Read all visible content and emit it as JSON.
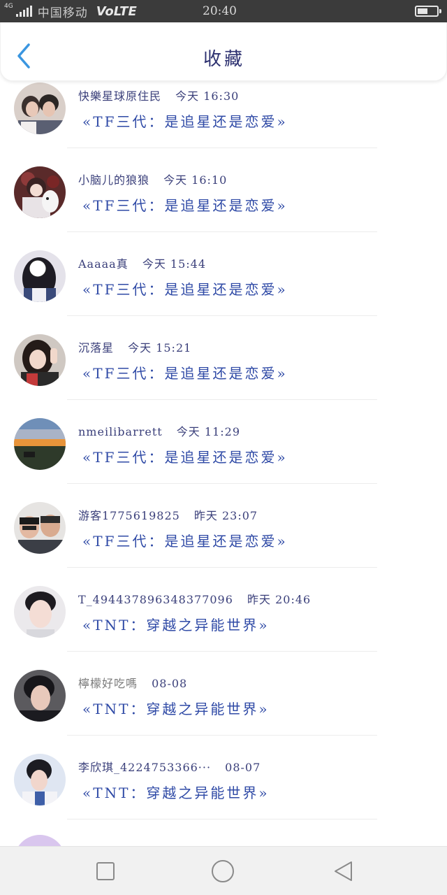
{
  "status_bar": {
    "network": "4G",
    "carrier": "中国移动",
    "volte": "VoLTE",
    "time": "20:40",
    "battery_level": 0.55
  },
  "header": {
    "back_icon": "chevron-left-icon",
    "title": "收藏"
  },
  "items": [
    {
      "name": "快樂星球原住民",
      "time": "今天 16:30",
      "book": "«TF三代：是追星还是恋爱»"
    },
    {
      "name": "小脑儿的狼狼",
      "time": "今天 16:10",
      "book": "«TF三代：是追星还是恋爱»"
    },
    {
      "name": "Aaaaa真",
      "time": "今天 15:44",
      "book": "«TF三代：是追星还是恋爱»"
    },
    {
      "name": "沉落星",
      "time": "今天 15:21",
      "book": "«TF三代：是追星还是恋爱»"
    },
    {
      "name": "nmeilibarrett",
      "time": "今天 11:29",
      "book": "«TF三代：是追星还是恋爱»"
    },
    {
      "name": "游客1775619825",
      "time": "昨天 23:07",
      "book": "«TF三代：是追星还是恋爱»"
    },
    {
      "name": "T_4944378963483770​96",
      "time": "昨天 20:46",
      "book": "«TNT：穿越之异能世界»"
    },
    {
      "name": "檸檬好吃嗎",
      "time": "08-08",
      "book": "«TNT：穿越之异能世界»"
    },
    {
      "name": "李欣琪_4224753366···",
      "time": "08-07",
      "book": "«TNT：穿越之异能世界»"
    }
  ],
  "nav_bar": {
    "recents_icon": "square-icon",
    "home_icon": "circle-icon",
    "back_icon": "triangle-back-icon"
  }
}
